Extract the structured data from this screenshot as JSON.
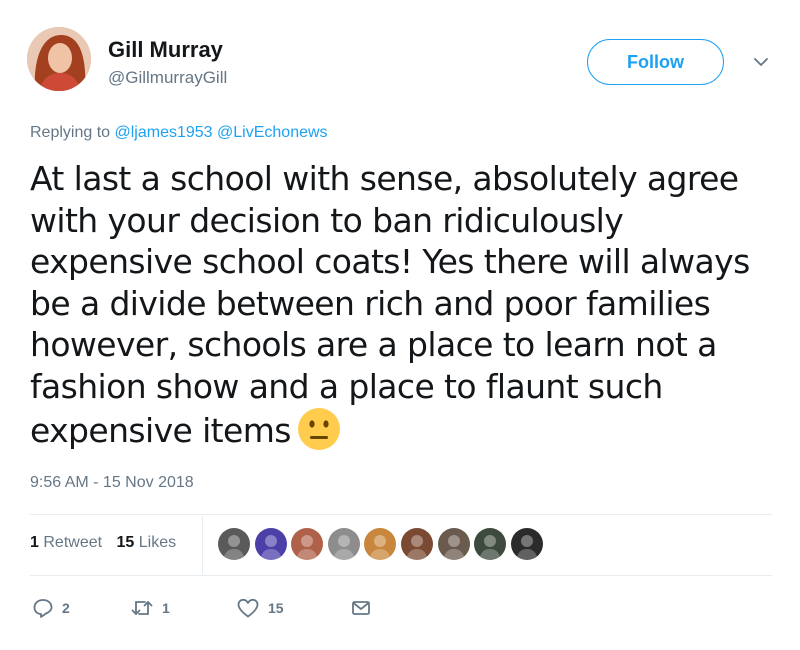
{
  "header": {
    "display_name": "Gill Murray",
    "handle": "@GillmurrayGill",
    "follow_label": "Follow",
    "avatar_icon": "user-avatar-photo",
    "menu_icon": "chevron-down-icon"
  },
  "reply": {
    "prefix": "Replying to",
    "mentions": [
      "@ljames1953",
      "@LivEchonews"
    ]
  },
  "tweet": {
    "text": "At last a school with sense, absolutely agree with your decision to ban ridiculously expensive school coats! Yes there will always be a divide between rich and poor families however, schools are a place to learn not a fashion show and a place to flaunt such expensive items",
    "emoji": "neutral-face-emoji",
    "timestamp": "9:56 AM - 15 Nov 2018"
  },
  "stats": {
    "retweets_count": "1",
    "retweets_label": "Retweet",
    "likes_count": "15",
    "likes_label": "Likes",
    "liker_avatars": [
      "#5a5a5a",
      "#4b3fa8",
      "#b0614a",
      "#8d8d8d",
      "#c9863d",
      "#7a4a33",
      "#6b5a4e",
      "#3e4a3e",
      "#2b2b2b"
    ]
  },
  "actions": {
    "reply_count": "2",
    "retweet_count": "1",
    "like_count": "15"
  },
  "colors": {
    "accent": "#1da1f2",
    "muted": "#657786",
    "text": "#14171a",
    "divider": "#e6ecf0"
  }
}
